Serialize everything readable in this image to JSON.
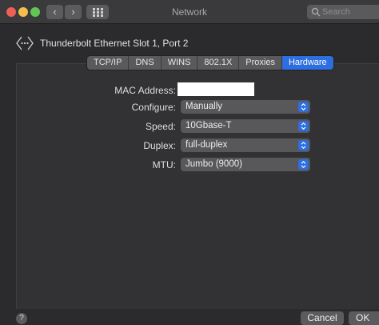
{
  "window": {
    "title": "Network",
    "search_placeholder": "Search"
  },
  "interface": {
    "name": "Thunderbolt Ethernet Slot  1, Port 2"
  },
  "tabs": [
    {
      "label": "TCP/IP"
    },
    {
      "label": "DNS"
    },
    {
      "label": "WINS"
    },
    {
      "label": "802.1X"
    },
    {
      "label": "Proxies"
    },
    {
      "label": "Hardware",
      "active": true
    }
  ],
  "form": {
    "mac_label": "MAC Address:",
    "configure_label": "Configure:",
    "configure_value": "Manually",
    "speed_label": "Speed:",
    "speed_value": "10Gbase-T",
    "duplex_label": "Duplex:",
    "duplex_value": "full-duplex",
    "mtu_label": "MTU:",
    "mtu_value": "Jumbo  (9000)"
  },
  "footer": {
    "help": "?",
    "cancel": "Cancel",
    "ok": "OK"
  },
  "colors": {
    "accent": "#2d6ee0",
    "close": "#ee5f57",
    "minimize": "#f4be4f",
    "zoom": "#61c554"
  }
}
